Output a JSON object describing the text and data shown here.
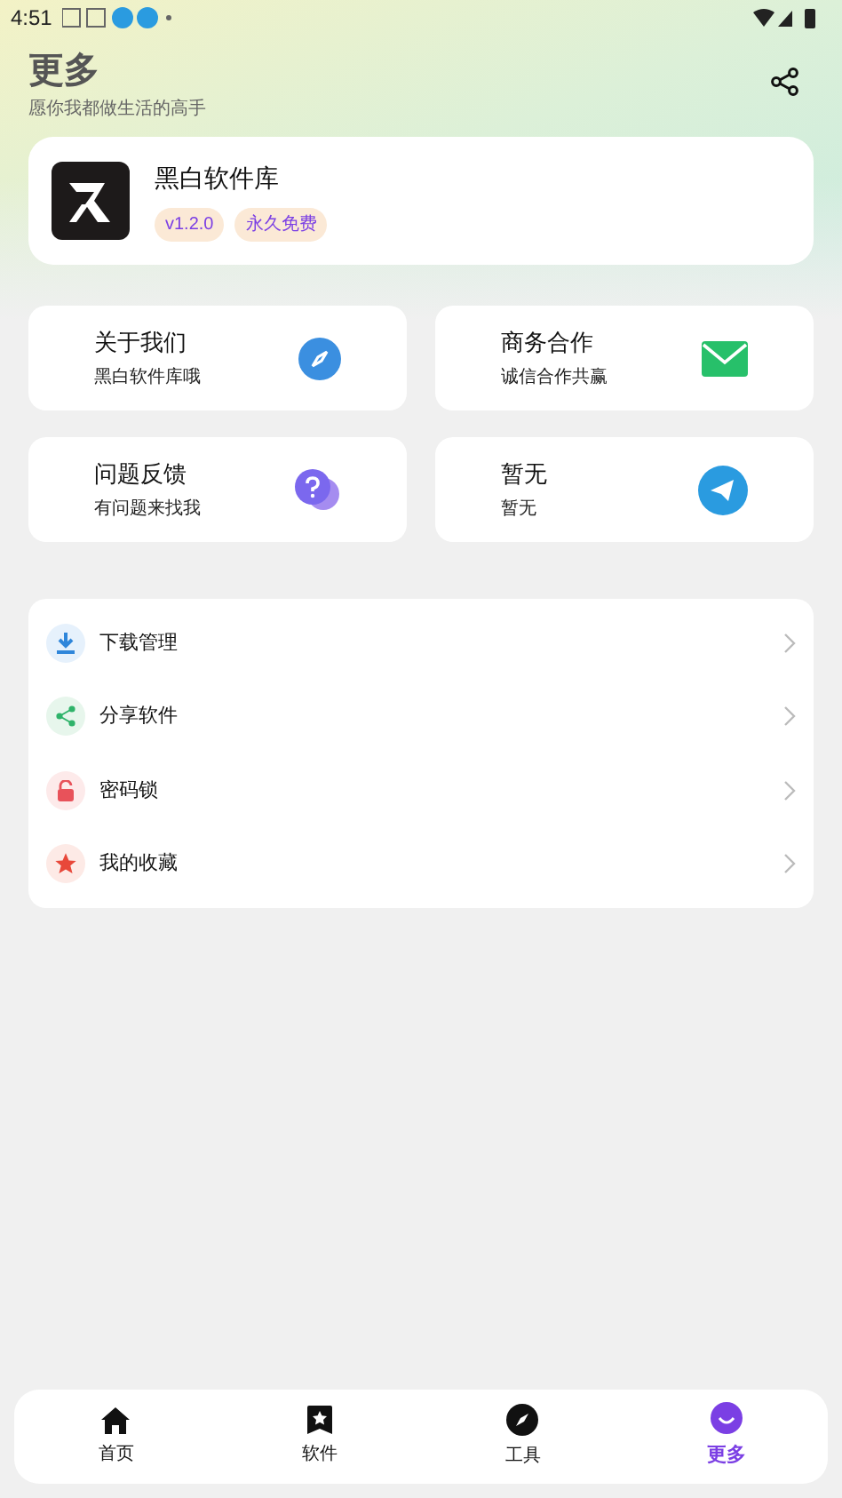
{
  "status_bar": {
    "time": "4:51"
  },
  "header": {
    "title": "更多",
    "subtitle": "愿你我都做生活的高手"
  },
  "app_card": {
    "name": "黑白软件库",
    "tags": [
      "v1.2.0",
      "永久免费"
    ]
  },
  "grid": [
    {
      "title": "关于我们",
      "subtitle": "黑白软件库哦",
      "kind": "compass"
    },
    {
      "title": "商务合作",
      "subtitle": "诚信合作共赢",
      "kind": "mail"
    },
    {
      "title": "问题反馈",
      "subtitle": "有问题来找我",
      "kind": "question"
    },
    {
      "title": "暂无",
      "subtitle": "暂无",
      "kind": "send"
    }
  ],
  "menu": [
    {
      "label": "下载管理",
      "kind": "download"
    },
    {
      "label": "分享软件",
      "kind": "share"
    },
    {
      "label": "密码锁",
      "kind": "lock"
    },
    {
      "label": "我的收藏",
      "kind": "star"
    }
  ],
  "tabs": [
    {
      "label": "首页",
      "kind": "home",
      "selected": false
    },
    {
      "label": "软件",
      "kind": "bookmark",
      "selected": false
    },
    {
      "label": "工具",
      "kind": "compass",
      "selected": false
    },
    {
      "label": "更多",
      "kind": "more",
      "selected": true
    }
  ]
}
